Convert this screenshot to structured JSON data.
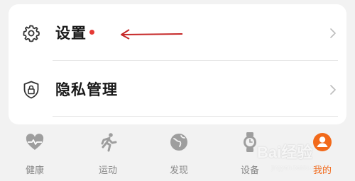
{
  "settings_list": {
    "items": [
      {
        "label": "设置",
        "icon": "gear-icon",
        "has_badge": true
      },
      {
        "label": "隐私管理",
        "icon": "shield-lock-icon",
        "has_badge": false
      }
    ],
    "badge_color": "#e53935",
    "annotation_arrow_color": "#c62828"
  },
  "tabbar": {
    "tabs": [
      {
        "label": "健康",
        "icon": "heart-pulse-icon",
        "active": false
      },
      {
        "label": "运动",
        "icon": "running-icon",
        "active": false
      },
      {
        "label": "发现",
        "icon": "planet-icon",
        "active": false
      },
      {
        "label": "设备",
        "icon": "watch-icon",
        "active": false
      },
      {
        "label": "我的",
        "icon": "profile-icon",
        "active": true
      }
    ],
    "active_color": "#f26a1b",
    "inactive_color": "#888888"
  },
  "watermark": {
    "text": "Bai经验",
    "sub": "jingyan.baidu.com"
  }
}
